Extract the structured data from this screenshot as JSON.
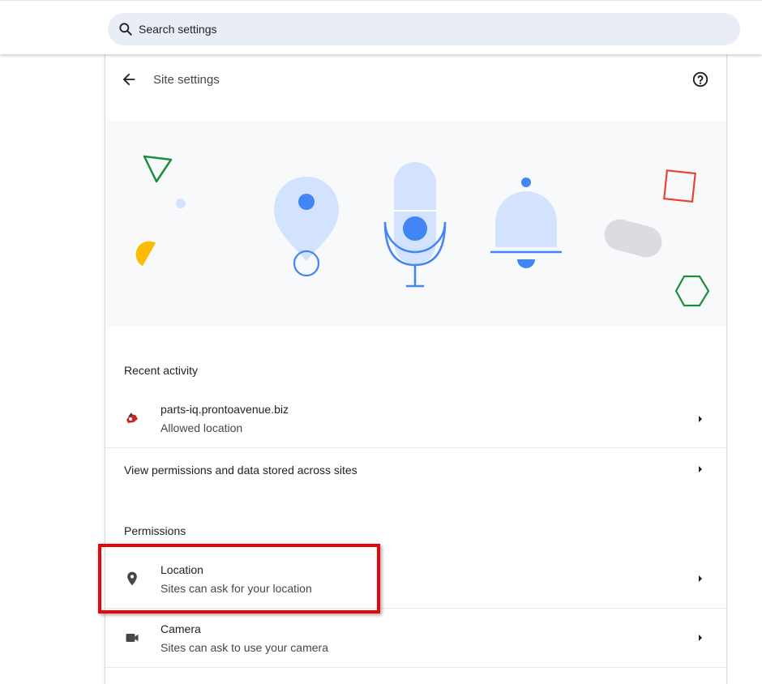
{
  "search": {
    "placeholder": "Search settings"
  },
  "header": {
    "title": "Site settings",
    "back_icon": "arrow-back-icon",
    "help_icon": "help-circle-icon"
  },
  "banner": {
    "illustrations": [
      "location-pin-icon",
      "microphone-icon",
      "notification-bell-icon"
    ]
  },
  "recent_activity": {
    "title": "Recent activity",
    "items": [
      {
        "site": "parts-iq.prontoavenue.biz",
        "status": "Allowed location",
        "favicon": "site-favicon"
      }
    ]
  },
  "view_all": {
    "label": "View permissions and data stored across sites"
  },
  "permissions": {
    "title": "Permissions",
    "items": [
      {
        "label": "Location",
        "description": "Sites can ask for your location",
        "icon": "location-pin-icon"
      },
      {
        "label": "Camera",
        "description": "Sites can ask to use your camera",
        "icon": "videocam-icon"
      }
    ]
  },
  "colors": {
    "accent_blue": "#4285f4",
    "light_blue": "#d3e3fd",
    "highlight_red": "#e8050a",
    "banner_bg": "#f8f9fa"
  }
}
